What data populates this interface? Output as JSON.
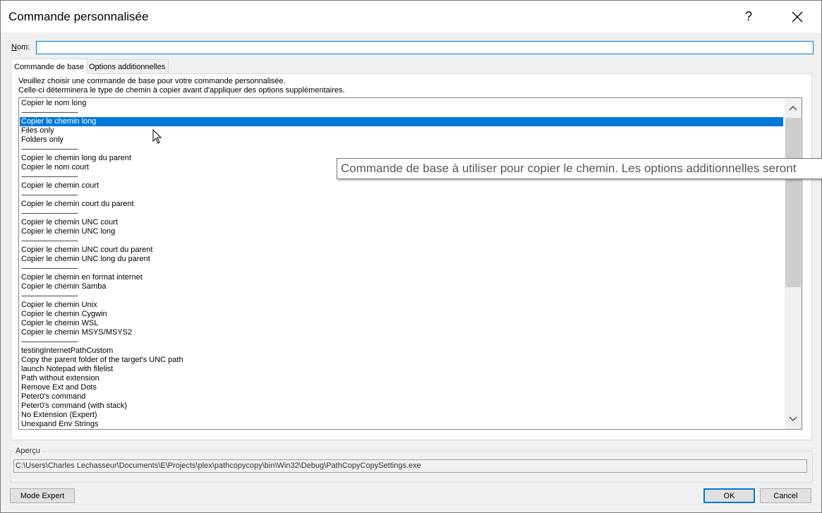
{
  "window": {
    "title": "Commande personnalisée",
    "help_label": "?",
    "close_label": "✕"
  },
  "name_field": {
    "label_prefix": "N",
    "label_rest": "om:",
    "value": ""
  },
  "tabs": [
    {
      "label": "Commande de base",
      "active": true
    },
    {
      "label": "Options additionnelles",
      "active": false
    }
  ],
  "description": {
    "line1": "Veuillez choisir une commande de base pour votre commande personnalisée.",
    "line2": "Celle-ci déterminera le type de chemin à copier avant d'appliquer des options supplémentaires."
  },
  "list": {
    "items": [
      {
        "label": "Copier le nom long"
      },
      {
        "label": "----------------------------------------",
        "separator": true
      },
      {
        "label": "Copier le chemin long",
        "selected": true
      },
      {
        "label": "Files only"
      },
      {
        "label": "Folders only"
      },
      {
        "label": "----------------------------------------",
        "separator": true
      },
      {
        "label": "Copier le chemin long du parent"
      },
      {
        "label": "Copier le nom court"
      },
      {
        "label": "----------------------------------------",
        "separator": true
      },
      {
        "label": "Copier le chemin court"
      },
      {
        "label": "----------------------------------------",
        "separator": true
      },
      {
        "label": "Copier le chemin court du parent"
      },
      {
        "label": "----------------------------------------",
        "separator": true
      },
      {
        "label": "Copier le chemin UNC court"
      },
      {
        "label": "Copier le chemin UNC long"
      },
      {
        "label": "----------------------------------------",
        "separator": true
      },
      {
        "label": "Copier le chemin UNC court du parent"
      },
      {
        "label": "Copier le chemin UNC long du parent"
      },
      {
        "label": "----------------------------------------",
        "separator": true
      },
      {
        "label": "Copier le chemin en format internet"
      },
      {
        "label": "Copier le chemin Samba"
      },
      {
        "label": "----------------------------------------",
        "separator": true
      },
      {
        "label": "Copier le chemin Unix"
      },
      {
        "label": "Copier le chemin Cygwin"
      },
      {
        "label": "Copier le chemin WSL"
      },
      {
        "label": "Copier le chemin MSYS/MSYS2"
      },
      {
        "label": "----------------------------------------",
        "separator": true
      },
      {
        "label": "testingInternetPathCustom"
      },
      {
        "label": "Copy the parent folder of the target's UNC path"
      },
      {
        "label": "launch Notepad with filelist"
      },
      {
        "label": "Path without extension"
      },
      {
        "label": "Remove Ext and Dots"
      },
      {
        "label": "Peter0's command"
      },
      {
        "label": "Peter0's command (with stack)"
      },
      {
        "label": "No Extension (Expert)"
      },
      {
        "label": "Unexpand Env Strings"
      }
    ]
  },
  "tooltip": {
    "text": "Commande de base à utiliser pour copier le chemin. Les options additionnelles seront"
  },
  "preview": {
    "label": "Aperçu",
    "value": "C:\\Users\\Charles Lechasseur\\Documents\\E\\Projects\\plex\\pathcopycopy\\bin\\Win32\\Debug\\PathCopyCopySettings.exe"
  },
  "buttons": {
    "expert": "Mode Expert",
    "ok": "OK",
    "cancel": "Cancel"
  },
  "colors": {
    "selection": "#0078d7",
    "focus_border": "#0078d7"
  }
}
